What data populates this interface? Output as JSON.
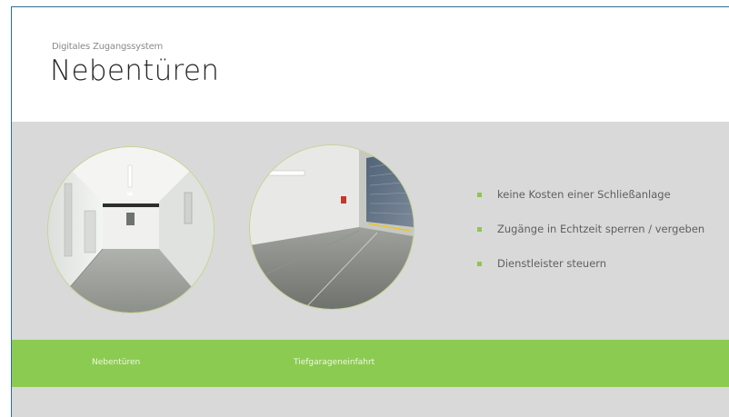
{
  "slide": {
    "subtitle": "Digitales Zugangssystem",
    "title": "Nebentüren"
  },
  "bullets": [
    "keine Kosten einer Schließanlage",
    "Zugänge in Echtzeit sperren / vergeben",
    "Dienstleister steuern"
  ],
  "captions": {
    "left": "Nebentüren",
    "right": "Tiefgarageneinfahrt"
  },
  "colors": {
    "accent_green": "#8ccb52",
    "panel_gray": "#d9d9d9",
    "title_text": "#262626"
  },
  "icons": {
    "bullet": "green-square-bullet"
  }
}
